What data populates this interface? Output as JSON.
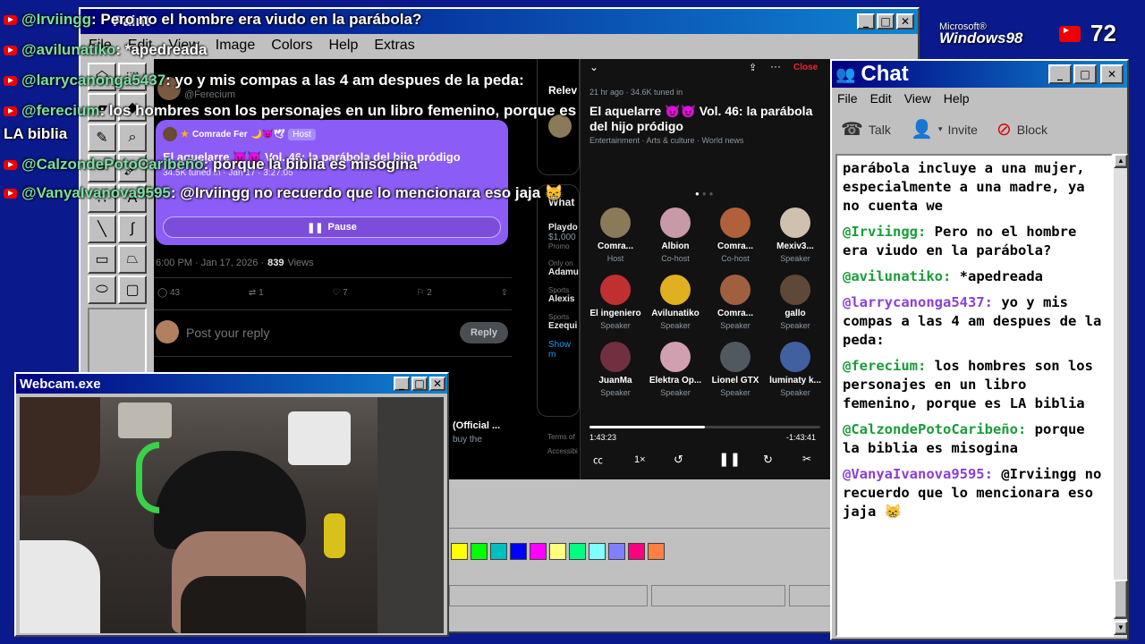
{
  "paint": {
    "title": "Paint",
    "menu": [
      "File",
      "Edit",
      "View",
      "Image",
      "Colors",
      "Help",
      "Extras"
    ],
    "palette": [
      "#ffff00",
      "#00ff00",
      "#00c0c0",
      "#0000ff",
      "#ff00ff",
      "#ffff80",
      "#00ff80",
      "#80ffff",
      "#8080ff",
      "#ff0080",
      "#ff8040"
    ]
  },
  "tweet": {
    "host_name": "Comrade Fer",
    "host_emojis": "🌙😈🕊",
    "host_badge": "Host",
    "space_title": "El aquelarre 😈😈 Vol. 46: la parábola del hijo pródigo",
    "tuned": "34.5K tuned in · Jan 17 · 3:27:05",
    "pause_label": "Pause",
    "timestamp": "6:00 PM · Jan 17, 2026 ·",
    "views_count": "839",
    "views_label": "Views",
    "reply_count": "43",
    "retweet_count": "1",
    "like_count": "7",
    "bookmark_count": "2",
    "reply_placeholder": "Post your reply",
    "reply_button": "Reply",
    "handle": "@Ferecium"
  },
  "sidebar": {
    "relevant": "Relev",
    "whats": "What",
    "playdo": "Playdo",
    "price": "$1,000",
    "promo": "Promo",
    "only_on": "Only on",
    "adamu": "Adamu",
    "sports1": "Sports",
    "alexis": "Alexis",
    "sports2": "Sports",
    "ezequ": "Ezequi",
    "show_more": "Show m",
    "terms": "Terms of",
    "access": "Accessibi",
    "official": "(Official ...",
    "buy": "buy the"
  },
  "space": {
    "close": "Close",
    "meta": "21 hr ago · 34.6K tuned in",
    "title": "El aquelarre 😈😈 Vol. 46: la parábola del hijo pródigo",
    "topics": "Entertainment · Arts & culture · World news",
    "speakers": [
      {
        "name": "Comra...",
        "role": "Host",
        "color": "#8a7a5a"
      },
      {
        "name": "Albion",
        "role": "Co-host",
        "color": "#c89aa8"
      },
      {
        "name": "Comra...",
        "role": "Co-host",
        "color": "#b0603a"
      },
      {
        "name": "Mexiv3...",
        "role": "Speaker",
        "color": "#d0c0b0"
      },
      {
        "name": "El ingeniero",
        "role": "Speaker",
        "color": "#c03030"
      },
      {
        "name": "Avilunatiko",
        "role": "Speaker",
        "color": "#e0b020"
      },
      {
        "name": "Comra...",
        "role": "Speaker",
        "color": "#a06040"
      },
      {
        "name": "gallo",
        "role": "Speaker",
        "color": "#604838"
      },
      {
        "name": "JuanMa",
        "role": "Speaker",
        "color": "#703040"
      },
      {
        "name": "Elektra Op...",
        "role": "Speaker",
        "color": "#d0a0b0"
      },
      {
        "name": "Lionel GTX",
        "role": "Speaker",
        "color": "#505860"
      },
      {
        "name": "luminaty k...",
        "role": "Speaker",
        "color": "#4060a0"
      }
    ],
    "elapsed": "1:43:23",
    "remaining": "-1:43:41",
    "speed": "1×",
    "progress": 0.5
  },
  "overlay": {
    "logo_line1": "Microsoft®",
    "logo_line2": "Windows98",
    "viewer_count": "72",
    "messages": [
      {
        "user": "@Irviingg",
        "text": ": Pero no el hombre era viudo en la parábola?"
      },
      {
        "user": "@avilunatiko",
        "text": ": *apedreada"
      },
      {
        "user": "@larrycanonga5437",
        "text": ": yo y mis compas a las 4 am despues de la peda:"
      },
      {
        "user": "@ferecium",
        "text": ": los hombres son los personajes en un libro femenino, porque es"
      },
      {
        "user": "",
        "text": "LA biblia"
      },
      {
        "user": "@CalzondePotoCaribeño",
        "text": ": porque la biblia es misogina"
      },
      {
        "user": "@VanyaIvanova9595",
        "text": ": @Irviingg no recuerdo que lo mencionara eso jaja 😸"
      }
    ]
  },
  "chat": {
    "title": "Chat",
    "menu": [
      "File",
      "Edit",
      "View",
      "Help"
    ],
    "talk": "Talk",
    "invite": "Invite",
    "block": "Block",
    "messages": [
      {
        "user": "",
        "text": "parábola incluye a una mujer, especialmente a una madre, ya no cuenta we"
      },
      {
        "user": "@Irviingg:",
        "text": " Pero no el hombre era viudo en la parábola?"
      },
      {
        "user": "@avilunatiko:",
        "text": " *apedreada"
      },
      {
        "user": "@larrycanonga5437:",
        "text": " yo y mis compas a las 4 am despues de la peda:"
      },
      {
        "user": "@ferecium:",
        "text": " los hombres son los personajes en un libro femenino, porque es LA biblia"
      },
      {
        "user": "@CalzondePotoCaribeño:",
        "text": " porque la biblia es misogina"
      },
      {
        "user": "@VanyaIvanova9595:",
        "text": " @Irviingg no recuerdo que lo mencionara eso jaja 😸"
      }
    ]
  },
  "webcam": {
    "title": "Webcam.exe"
  }
}
